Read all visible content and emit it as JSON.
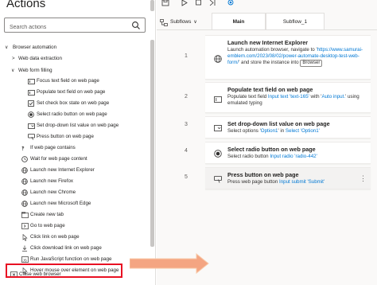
{
  "actions_pane": {
    "title": "Actions",
    "search_placeholder": "Search actions",
    "categories": [
      {
        "label": "Browser automation",
        "expanded": true
      },
      {
        "label": "Web data extraction",
        "expanded": false
      },
      {
        "label": "Web form filling",
        "expanded": true
      }
    ],
    "form_filling_items": [
      {
        "label": "Focus text field on web page",
        "icon": "text-field-icon"
      },
      {
        "label": "Populate text field on web page",
        "icon": "text-field-icon"
      },
      {
        "label": "Set check box state on web page",
        "icon": "checkbox-icon"
      },
      {
        "label": "Select radio button on web page",
        "icon": "radio-button-icon"
      },
      {
        "label": "Set drop-down list value on web page",
        "icon": "dropdown-icon"
      },
      {
        "label": "Press button on web page",
        "icon": "button-press-icon"
      }
    ],
    "browser_items": [
      {
        "label": "If web page contains",
        "icon": "if-condition-icon"
      },
      {
        "label": "Wait for web page content",
        "icon": "wait-icon"
      },
      {
        "label": "Launch new Internet Explorer",
        "icon": "globe-icon"
      },
      {
        "label": "Launch new Firefox",
        "icon": "globe-icon"
      },
      {
        "label": "Launch new Chrome",
        "icon": "globe-icon"
      },
      {
        "label": "Launch new Microsoft Edge",
        "icon": "globe-icon"
      },
      {
        "label": "Create new tab",
        "icon": "new-tab-icon"
      },
      {
        "label": "Go to web page",
        "icon": "go-to-page-icon"
      },
      {
        "label": "Click link on web page",
        "icon": "click-icon"
      },
      {
        "label": "Click download link on web page",
        "icon": "download-icon"
      },
      {
        "label": "Run JavaScript function on web page",
        "icon": "javascript-icon"
      },
      {
        "label": "Hover mouse over element on web page",
        "icon": "hover-icon"
      },
      {
        "label": "Close web browser",
        "icon": "close-browser-icon"
      }
    ]
  },
  "flow_pane": {
    "subflows_label": "Subflows",
    "tabs": [
      {
        "label": "Main",
        "active": true
      },
      {
        "label": "Subflow_1",
        "active": false
      }
    ],
    "steps": [
      {
        "number": "1",
        "title": "Launch new Internet Explorer",
        "icon": "globe-icon",
        "desc_pre": "Launch automation browser, navigate to '",
        "desc_link": "https://www.samurai-emblem.com/2023/08/02/power-automate-desktop-test-web-form/",
        "desc_mid": "' and store the instance into ",
        "desc_badge": "Browser"
      },
      {
        "number": "2",
        "title": "Populate text field on web page",
        "icon": "text-field-icon",
        "desc_pre": "Populate text field ",
        "desc_hl1": "Input text 'text-165'",
        "desc_mid": " with '",
        "desc_hl2": "Auto input.",
        "desc_post": "' using emulated typing"
      },
      {
        "number": "3",
        "title": "Set drop-down list value on web page",
        "icon": "dropdown-icon",
        "desc_pre": "Select options '",
        "desc_hl1": "Option1",
        "desc_mid": "' in ",
        "desc_hl2": "Select 'Option1'"
      },
      {
        "number": "4",
        "title": "Select radio button on web page",
        "icon": "radio-button-icon",
        "desc_pre": "Select radio button ",
        "desc_hl1": "Input radio 'radio-442'"
      },
      {
        "number": "5",
        "title": "Press button on web page",
        "icon": "button-press-icon",
        "desc_pre": "Press web page button ",
        "desc_hl1": "Input submit 'Submit'"
      }
    ]
  },
  "colors": {
    "accent": "#0078d4",
    "highlight_border": "#e81123",
    "arrow_fill": "#f4a582",
    "arrow_stroke": "#f8c9a8"
  }
}
